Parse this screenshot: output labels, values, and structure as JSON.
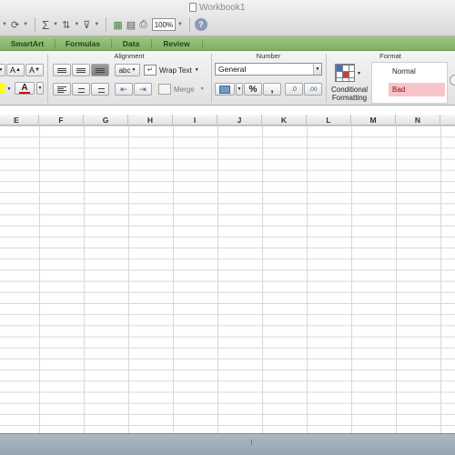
{
  "window": {
    "title": "Workbook1"
  },
  "toolbar": {
    "zoom": "100%"
  },
  "tabs": [
    {
      "label": "SmartArt"
    },
    {
      "label": "Formulas"
    },
    {
      "label": "Data"
    },
    {
      "label": "Review"
    }
  ],
  "ribbon": {
    "groups": {
      "alignment": "Alignment",
      "number": "Number",
      "format": "Format"
    },
    "font": {
      "increase_size": "A",
      "decrease_size": "A",
      "font_color": "A"
    },
    "alignment": {
      "orientation": "abc",
      "wrap_text": "Wrap Text",
      "merge": "Merge"
    },
    "number": {
      "format_value": "General",
      "percent": "%",
      "comma": ",",
      "increase_decimal": ".0",
      "decrease_decimal": ".00"
    },
    "conditional_formatting": {
      "line1": "Conditional",
      "line2": "Formatting"
    },
    "styles": {
      "normal": "Normal",
      "bad": "Bad"
    }
  },
  "grid": {
    "columns": [
      "E",
      "F",
      "G",
      "H",
      "I",
      "J",
      "K",
      "L",
      "M",
      "N"
    ]
  },
  "colors": {
    "tab_bar": "#8ebb72",
    "bad_fill": "#f6c5cc",
    "bad_text": "#9c0006",
    "font_color_bar": "#e00000",
    "highlight_bar": "#ffff00"
  }
}
